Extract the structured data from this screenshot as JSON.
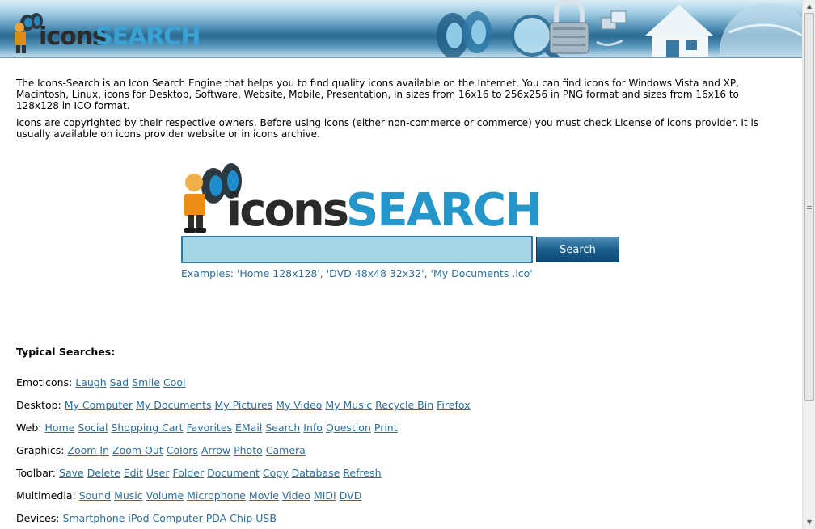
{
  "header": {
    "logo_icons": "icons",
    "logo_search": "SEARCH"
  },
  "intro": {
    "p1": "The Icons-Search is an Icon Search Engine that helps you to find quality icons available on the Internet. You can find icons for Windows Vista and XP, Macintosh, Linux, icons for Desktop, Software, Website, Mobile, Presentation, in sizes from 16x16 to 256x256 in PNG format and sizes from 16x16 to 128x128 in ICO format.",
    "p2": "Icons are copyrighted by their respective owners. Before using icons (either non-commerce or commerce) you must check License of icons provider. It is usually available on icons provider website or in icons archive."
  },
  "search": {
    "logo_icons": "icons",
    "logo_search": "SEARCH",
    "input_value": "",
    "button_label": "Search",
    "examples": "Examples: 'Home 128x128', 'DVD 48x48 32x32', 'My Documents .ico'"
  },
  "typical": {
    "title": "Typical Searches:",
    "categories": [
      {
        "label": "Emoticons:",
        "links": [
          "Laugh",
          "Sad",
          "Smile",
          "Cool"
        ]
      },
      {
        "label": "Desktop:",
        "links": [
          "My Computer",
          "My Documents",
          "My Pictures",
          "My Video",
          "My Music",
          "Recycle Bin",
          "Firefox"
        ]
      },
      {
        "label": "Web:",
        "links": [
          "Home",
          "Social",
          "Shopping Cart",
          "Favorites",
          "EMail",
          "Search",
          "Info",
          "Question",
          "Print"
        ]
      },
      {
        "label": "Graphics:",
        "links": [
          "Zoom In",
          "Zoom Out",
          "Colors",
          "Arrow",
          "Photo",
          "Camera"
        ]
      },
      {
        "label": "Toolbar:",
        "links": [
          "Save",
          "Delete",
          "Edit",
          "User",
          "Folder",
          "Document",
          "Copy",
          "Database",
          "Refresh"
        ]
      },
      {
        "label": "Multimedia:",
        "links": [
          "Sound",
          "Music",
          "Volume",
          "Microphone",
          "Movie",
          "Video",
          "MIDI",
          "DVD"
        ]
      },
      {
        "label": "Devices:",
        "links": [
          "Smartphone",
          "iPod",
          "Computer",
          "PDA",
          "Chip",
          "USB"
        ]
      }
    ]
  },
  "colors": {
    "link": "#2a6f9e",
    "input_bg": "#a6d5e6",
    "button_bg": "#1a5f8d"
  }
}
